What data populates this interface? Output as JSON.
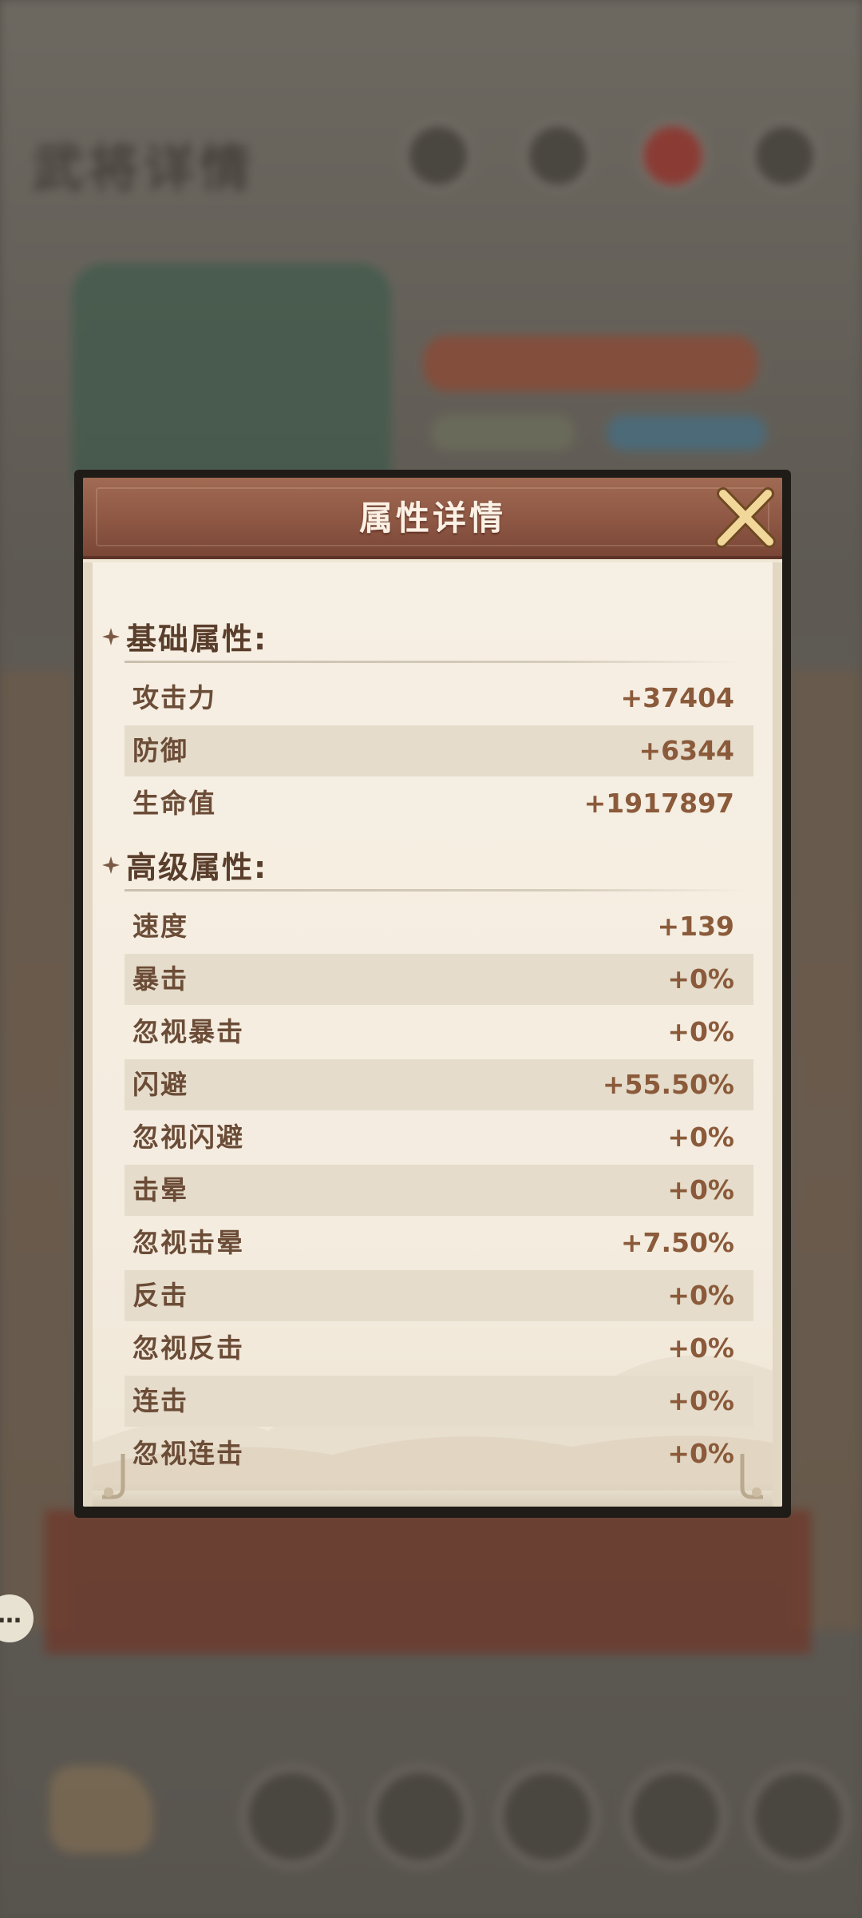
{
  "background": {
    "page_title": "武将详情",
    "chat_icon_text": "…"
  },
  "dialog": {
    "title": "属性详情",
    "close_icon": "close-x-icon",
    "sections": [
      {
        "title": "基础属性:",
        "stats": [
          {
            "name": "攻击力",
            "value": "+37404"
          },
          {
            "name": "防御",
            "value": "+6344"
          },
          {
            "name": "生命值",
            "value": "+1917897"
          }
        ]
      },
      {
        "title": "高级属性:",
        "stats": [
          {
            "name": "速度",
            "value": "+139"
          },
          {
            "name": "暴击",
            "value": "+0%"
          },
          {
            "name": "忽视暴击",
            "value": "+0%"
          },
          {
            "name": "闪避",
            "value": "+55.50%"
          },
          {
            "name": "忽视闪避",
            "value": "+0%"
          },
          {
            "name": "击晕",
            "value": "+0%"
          },
          {
            "name": "忽视击晕",
            "value": "+7.50%"
          },
          {
            "name": "反击",
            "value": "+0%"
          },
          {
            "name": "忽视反击",
            "value": "+0%"
          },
          {
            "name": "连击",
            "value": "+0%"
          },
          {
            "name": "忽视连击",
            "value": "+0%"
          }
        ]
      }
    ]
  },
  "colors": {
    "header": "#8d5744",
    "panel": "#f4ecdf",
    "row_shade": "#e5dccb",
    "label": "#6b4c37",
    "value": "#8a5a3a",
    "frame": "#1f1b17"
  }
}
